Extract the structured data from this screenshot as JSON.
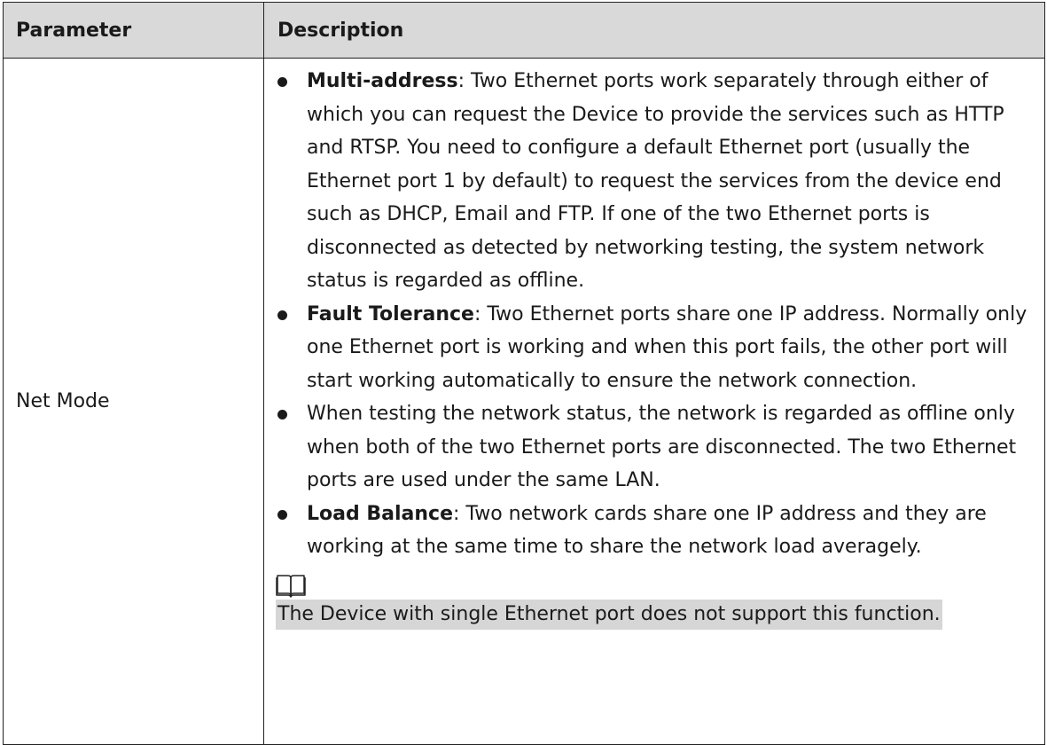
{
  "table": {
    "headers": {
      "parameter": "Parameter",
      "description": "Description"
    },
    "row": {
      "parameter": "Net Mode",
      "bullets": [
        {
          "term": "Multi-address",
          "text": ": Two Ethernet ports work separately through either of which you can request the Device to provide the services such as HTTP and RTSP. You need to configure a default Ethernet port (usually the Ethernet port 1 by default) to request the services from the device end such as DHCP, Email and FTP. If one of the two Ethernet ports is disconnected as detected by networking testing, the system network status is regarded as offline."
        },
        {
          "term": "Fault Tolerance",
          "text": ": Two Ethernet ports share one IP address. Normally only one Ethernet port is working and when this port fails, the other port will start working automatically to ensure the network connection."
        },
        {
          "term": "",
          "text": "When testing the network status, the network is regarded as offline only when both of the two Ethernet ports are disconnected. The two Ethernet ports are used under the same LAN."
        },
        {
          "term": "Load Balance",
          "text": ": Two network cards share one IP address and they are working at the same time to share the network load averagely."
        }
      ],
      "note": {
        "icon": "book-note-icon",
        "text": "The Device with single Ethernet port does not support this function."
      }
    }
  }
}
